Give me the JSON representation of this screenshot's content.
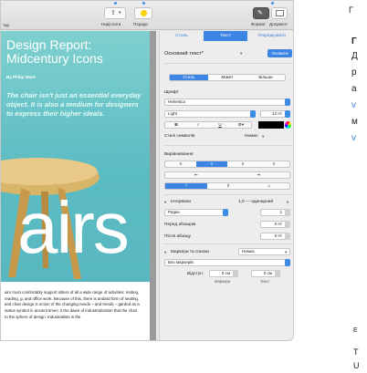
{
  "toolbar": {
    "left_partial_label": "тар",
    "share_label": "Надіслати",
    "tips_label": "Поради",
    "format_label": "Формат",
    "document_label": "Документ"
  },
  "document": {
    "title": "Design Report: Midcentury Icons",
    "byline": "By Philip Ward",
    "quote": "The chair isn't just an essential everyday object. It is also a medium for designers to express their higher ideals.",
    "big_word": "airs",
    "body": "airs must comfortably support sitters of all a wide range of activities: resting, reading, g, and office work. Because of this, there is andard form of seating, and chair design is ection of the changing needs – and trends – garded as a status symbol in ancient times, it the dawn of industrialization that the chair to the sphere of design. Industrialists in the"
  },
  "inspector": {
    "tabs": [
      "Стиль",
      "Текст",
      "Упорядкувати"
    ],
    "active_tab": 1,
    "paragraph_style": "Основний текст*",
    "update_button": "Оновити",
    "subtabs": [
      "Стиль",
      "Макет",
      "Більше"
    ],
    "font_section": "Шрифт",
    "font_family": "Helvetica",
    "font_weight": "Light",
    "font_size": "12 пт",
    "format_buttons": [
      "B",
      "I",
      "U",
      "⚙▾"
    ],
    "char_styles_label": "Стилі символів",
    "char_styles_value": "Немає",
    "alignment_section": "Вирівнювання",
    "spacing_label": "Інтервали",
    "spacing_value": "1,0 — одинарний",
    "lines_label": "Рядки",
    "lines_value": "1",
    "before_para_label": "Перед абзацом",
    "before_para_value": "0 пт",
    "after_para_label": "Після абзацу",
    "after_para_value": "0 пт",
    "bullets_label": "Маркери та списки",
    "bullets_value": "Немає",
    "no_bullets": "Без маркерів",
    "indent_label": "Відступ:",
    "indent_bullets_value": "0 см",
    "indent_text_value": "0 см",
    "indent_bullets_caption": "Маркери",
    "indent_text_caption": "Текст"
  },
  "side_text": {
    "line1": "Г",
    "line2": "Г",
    "line3": "Д",
    "line4": "р",
    "line5": "а",
    "line6": "v",
    "line7": "м",
    "line8": "v",
    "line9": "Е",
    "line10": "Т",
    "line11": "U"
  },
  "colors": {
    "accent": "#3d85e5",
    "hero": "#5cbcc3"
  }
}
